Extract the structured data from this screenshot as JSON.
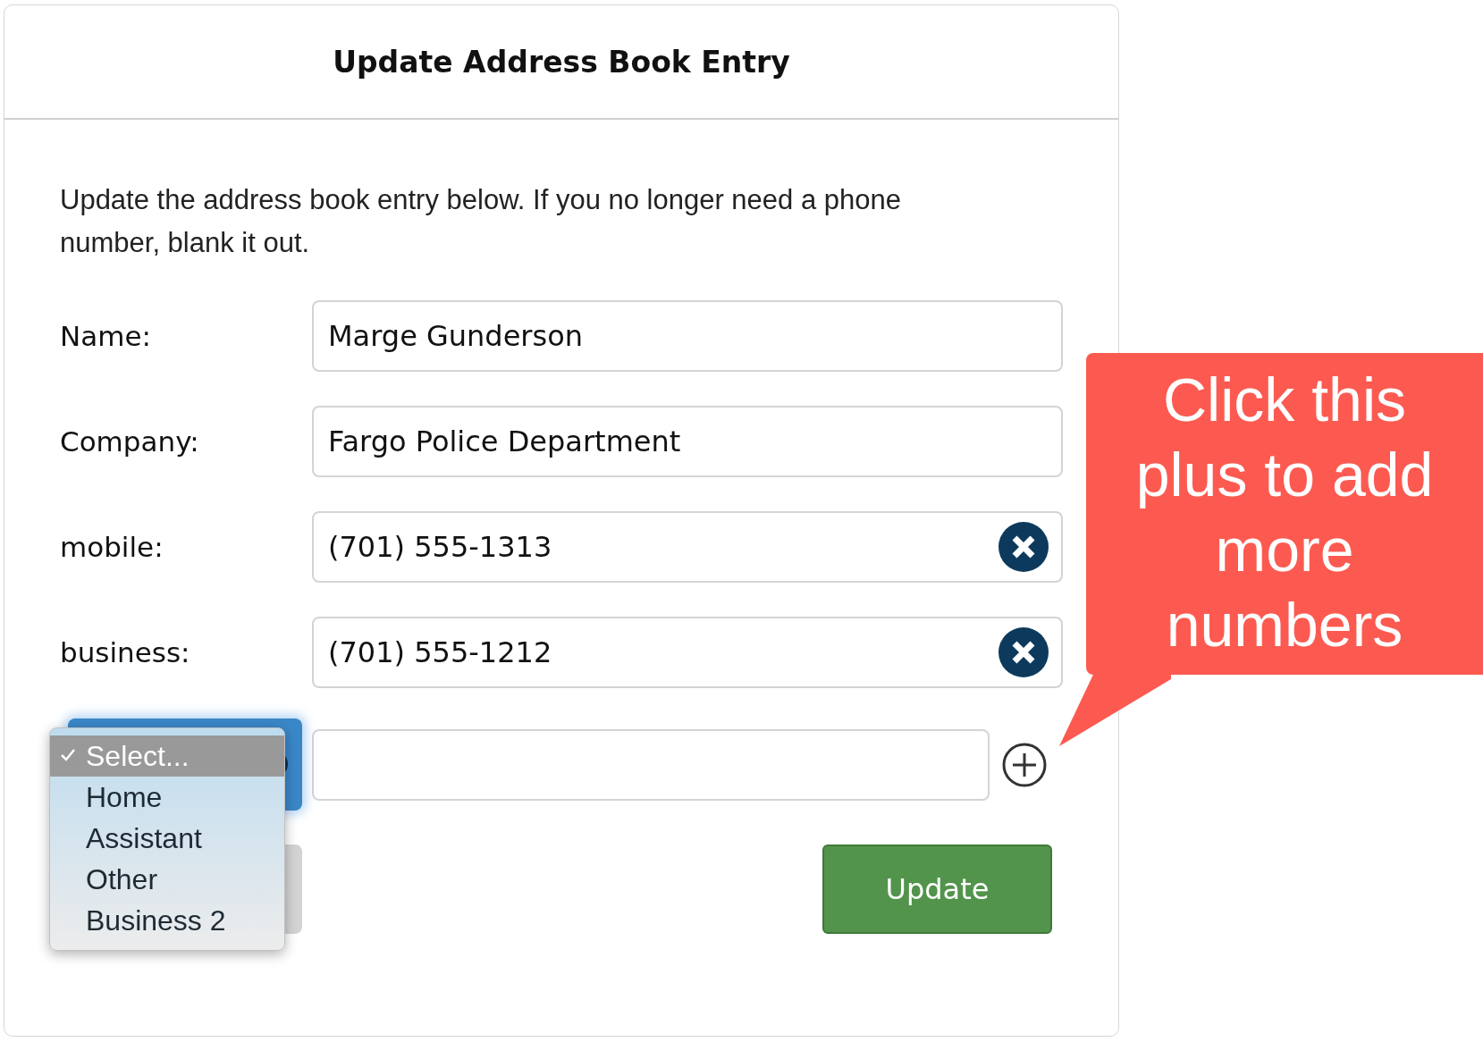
{
  "dialog": {
    "title": "Update Address Book Entry",
    "intro": "Update the address book entry below. If you no longer need a phone number, blank it out.",
    "fields": [
      {
        "label": "Name:",
        "value": "Marge Gunderson",
        "clearable": false
      },
      {
        "label": "Company:",
        "value": "Fargo Police Department",
        "clearable": false
      },
      {
        "label": "mobile:",
        "value": "(701) 555-1313",
        "clearable": true
      },
      {
        "label": "business:",
        "value": "(701) 555-1212",
        "clearable": true
      }
    ],
    "type_menu": {
      "options": [
        {
          "label": "Select...",
          "selected": true
        },
        {
          "label": "Home",
          "selected": false
        },
        {
          "label": "Assistant",
          "selected": false
        },
        {
          "label": "Other",
          "selected": false
        },
        {
          "label": "Business 2",
          "selected": false
        }
      ]
    },
    "update_button": "Update"
  },
  "callout": {
    "text": "Click this plus to add more numbers"
  }
}
